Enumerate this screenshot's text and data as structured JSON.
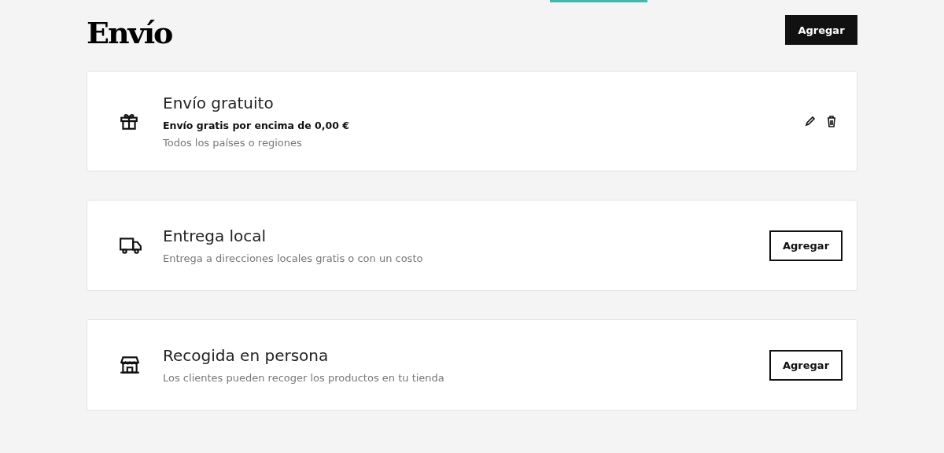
{
  "header": {
    "title": "Envío",
    "button": "Agregar"
  },
  "methods": [
    {
      "kind": "configured",
      "title": "Envío gratuito",
      "detail": "Envío gratis por encima de 0,00 €",
      "description": "Todos los países o regiones"
    },
    {
      "kind": "available",
      "title": "Entrega local",
      "description": "Entrega a direcciones locales gratis o con un costo",
      "button": "Agregar"
    },
    {
      "kind": "available",
      "title": "Recogida en persona",
      "description": "Los clientes pueden recoger los productos en tu tienda",
      "button": "Agregar"
    }
  ]
}
